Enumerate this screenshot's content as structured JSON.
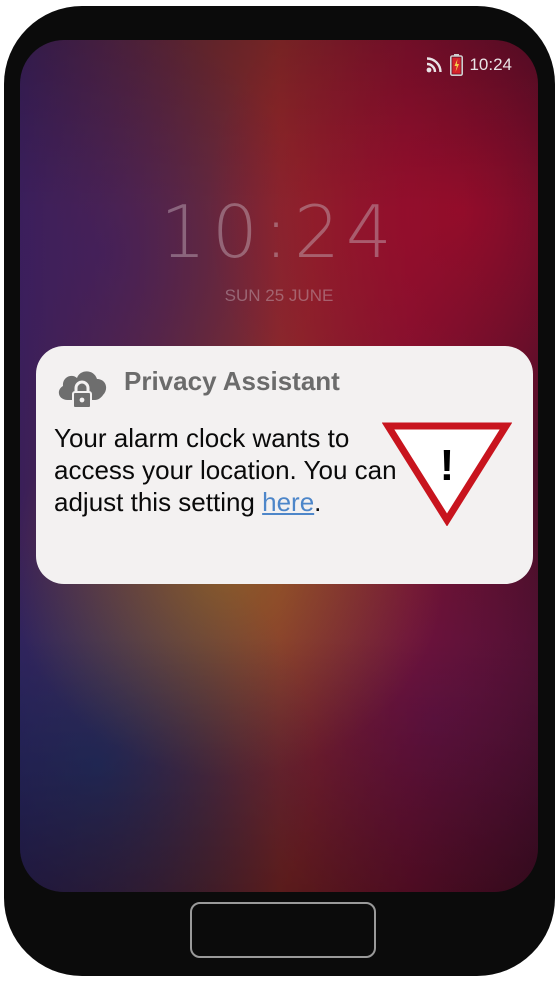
{
  "status_bar": {
    "time": "10:24",
    "icons": [
      "wifi-icon",
      "battery-icon"
    ]
  },
  "lock_screen": {
    "time": "10:24",
    "date": "SUN 25 JUNE"
  },
  "notification": {
    "app_name": "Privacy Assistant",
    "icon": "cloud-lock-icon",
    "message": "Your alarm clock wants to access your location. You can adjust this setting ",
    "link_text": "here",
    "trailing": ".",
    "warning_icon_symbol": "!"
  },
  "colors": {
    "link": "#4d86c9",
    "warning_red": "#c8141e",
    "title_gray": "#6b6b6b",
    "battery_red": "#d4232b"
  }
}
